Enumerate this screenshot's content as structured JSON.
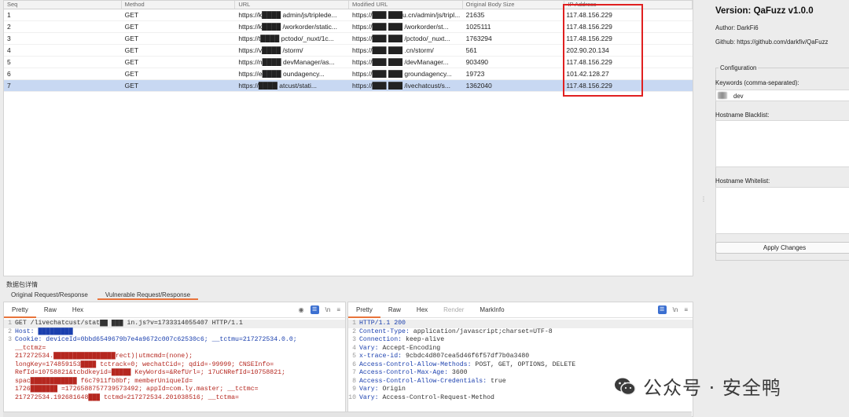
{
  "table": {
    "headers": [
      "Seq",
      "Method",
      "URL",
      "Modified URL",
      "Original Body Size",
      "IP Address"
    ],
    "rows": [
      {
        "seq": "1",
        "method": "GET",
        "url": "https://k████ admin/js/triplede...",
        "mod_url": "https://███ ███u.cn/admin/js/tripl...",
        "size": "21635",
        "ip": "117.48.156.229"
      },
      {
        "seq": "2",
        "method": "GET",
        "url": "https://k████ /workorder/static...",
        "mod_url": "https://███ ███ /workorder/st...",
        "size": "1025111",
        "ip": "117.48.156.229"
      },
      {
        "seq": "3",
        "method": "GET",
        "url": "https://t████ pctodo/_nuxt/1c...",
        "mod_url": "https://███ ███ /pctodo/_nuxt...",
        "size": "1763294",
        "ip": "117.48.156.229"
      },
      {
        "seq": "4",
        "method": "GET",
        "url": "https://v████ /storm/",
        "mod_url": "https://███ ███ .cn/storm/",
        "size": "561",
        "ip": "202.90.20.134"
      },
      {
        "seq": "5",
        "method": "GET",
        "url": "https://n████ devManager/as...",
        "mod_url": "https://███ ███ /devManager...",
        "size": "903490",
        "ip": "117.48.156.229"
      },
      {
        "seq": "6",
        "method": "GET",
        "url": "https://e████ oundagency...",
        "mod_url": "https://███ ███ groundagency...",
        "size": "19723",
        "ip": "101.42.128.27"
      },
      {
        "seq": "7",
        "method": "GET",
        "url": "https://████ atcust/stati...",
        "mod_url": "https://███ ███ /ivechatcust/s...",
        "size": "1362040",
        "ip": "117.48.156.229"
      }
    ]
  },
  "detail": {
    "title": "数据包详情",
    "tabs": [
      "Original Request/Response",
      "Vulnerable Request/Response"
    ],
    "active_tab_index": 1
  },
  "request": {
    "tabs": [
      "Pretty",
      "Raw",
      "Hex"
    ],
    "lines": [
      {
        "n": "1",
        "text": "GET /livechatcust/stat██ ███ in.js?v=1733314055407 HTTP/1.1",
        "style": "plain"
      },
      {
        "n": "2",
        "text": "Host: █████████",
        "style": "k"
      },
      {
        "n": "3",
        "text": "Cookie: deviceId=0bbd6549679b7e4a9672c007c62530c6; __tctmu=217272534.0.0;",
        "style": "k"
      },
      {
        "n": "",
        "text": "__tctmz=",
        "style": "v"
      },
      {
        "n": "",
        "text": "217272534.████████████████rect)|utmcmd=(none);",
        "style": "v"
      },
      {
        "n": "",
        "text": "longKey=174859153████ tctrack=0; wechatCid=; qdid=-99999; CNSEInfo=",
        "style": "v"
      },
      {
        "n": "",
        "text": "RefId=10758821&tcbdkeyid=█████ KeyWords=&RefUrl=; 17uCNRefId=10758821;",
        "style": "v"
      },
      {
        "n": "",
        "text": "spac████████████ f6c7911fb8bf; memberUniqueId=",
        "style": "v"
      },
      {
        "n": "",
        "text": "1726███████ =1726588757739573492; appId=com.ly.master; __tctmc=",
        "style": "v"
      },
      {
        "n": "",
        "text": "217272534.192681648███ tctmd=217272534.201038516; __tctma=",
        "style": "v"
      }
    ]
  },
  "response": {
    "tabs": [
      "Pretty",
      "Raw",
      "Hex",
      "Render",
      "MarkInfo"
    ],
    "lines": [
      {
        "n": "1",
        "key": "HTTP/1.1 200",
        "val": ""
      },
      {
        "n": "2",
        "key": "Content-Type: ",
        "val": "application/javascript;charset=UTF-8"
      },
      {
        "n": "3",
        "key": "Connection: ",
        "val": "keep-alive"
      },
      {
        "n": "4",
        "key": "Vary: ",
        "val": "Accept-Encoding"
      },
      {
        "n": "5",
        "key": "x-trace-id: ",
        "val": "9cbdc4d807cea5d46f6f57df7b0a3480"
      },
      {
        "n": "6",
        "key": "Access-Control-Allow-Methods: ",
        "val": "POST, GET, OPTIONS, DELETE"
      },
      {
        "n": "7",
        "key": "Access-Control-Max-Age: ",
        "val": "3600"
      },
      {
        "n": "8",
        "key": "Access-Control-Allow-Credentials: ",
        "val": "true"
      },
      {
        "n": "9",
        "key": "Vary: ",
        "val": "Origin"
      },
      {
        "n": "10",
        "key": "Vary: ",
        "val": "Access-Control-Request-Method"
      }
    ]
  },
  "sidebar": {
    "version": "Version: QaFuzz v1.0.0",
    "author": "Author: DarkFi6",
    "github": "Github: https://github.com/darkfiv/QaFuzz",
    "config_title": "Configuration",
    "keywords_label": "Keywords (comma-separated):",
    "keywords_value": "dev",
    "blacklist_label": "Hostname Blacklist:",
    "whitelist_label": "Hostname Whitelist:",
    "apply_label": "Apply Changes"
  },
  "watermark": {
    "text": "公众号 · 安全鸭"
  },
  "colors": {
    "highlight_box": "#e02020",
    "tab_accent": "#e8743b",
    "selected_row": "#c8d8f2"
  }
}
